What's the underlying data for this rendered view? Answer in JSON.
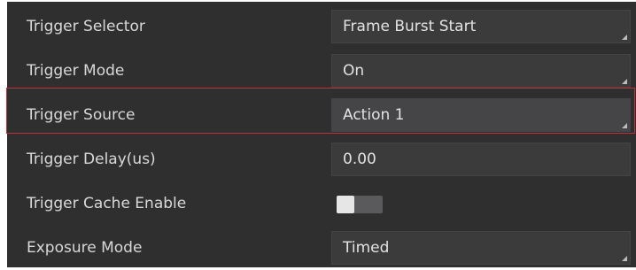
{
  "properties": [
    {
      "label": "Trigger Selector",
      "value": "Frame Burst Start",
      "kind": "select"
    },
    {
      "label": "Trigger Mode",
      "value": "On",
      "kind": "select"
    },
    {
      "label": "Trigger Source",
      "value": "Action 1",
      "kind": "select",
      "highlighted": true
    },
    {
      "label": "Trigger Delay(us)",
      "value": "0.00",
      "kind": "number"
    },
    {
      "label": "Trigger Cache Enable",
      "value": "",
      "kind": "toggle",
      "on": false
    },
    {
      "label": "Exposure Mode",
      "value": "Timed",
      "kind": "select"
    }
  ],
  "colors": {
    "panel_bg": "#2f2f30",
    "field_bg": "#3b3b3c",
    "text": "#d8d8d8",
    "highlight_border": "#c0323a"
  }
}
